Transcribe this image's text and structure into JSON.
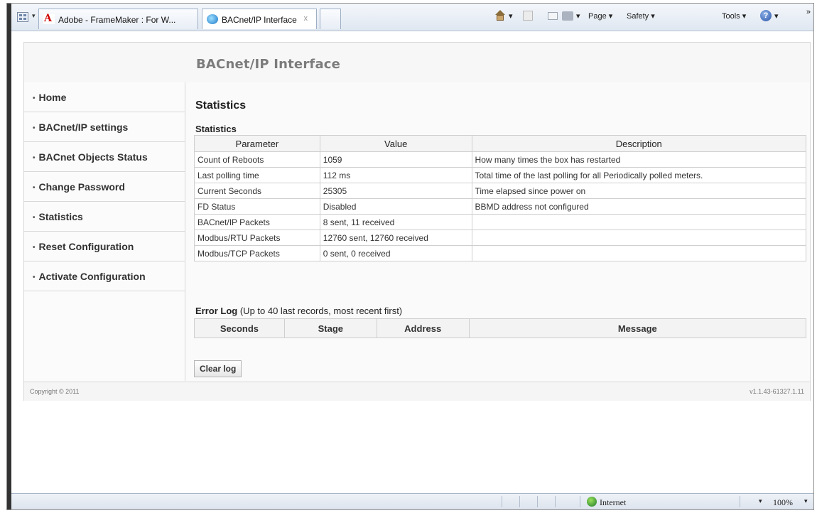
{
  "browser": {
    "tabs": [
      {
        "title": "Adobe - FrameMaker : For W..."
      },
      {
        "title": "BACnet/IP Interface"
      }
    ],
    "tab_close_glyph": "x",
    "commands": {
      "page": "Page",
      "safety": "Safety",
      "tools": "Tools"
    },
    "dropdown_glyph": "▾",
    "more_glyph": "»",
    "status": {
      "zone": "Internet",
      "zoom": "100%"
    }
  },
  "page": {
    "header_title": "BACnet/IP Interface",
    "nav": [
      {
        "label": "Home"
      },
      {
        "label": "BACnet/IP settings"
      },
      {
        "label": "BACnet Objects Status"
      },
      {
        "label": "Change Password"
      },
      {
        "label": "Statistics"
      },
      {
        "label": "Reset Configuration"
      },
      {
        "label": "Activate Configuration"
      }
    ],
    "content_title": "Statistics",
    "stats_section_label": "Statistics",
    "stats_table": {
      "headers": [
        "Parameter",
        "Value",
        "Description"
      ],
      "rows": [
        [
          "Count of Reboots",
          "1059",
          "How many times the box has restarted"
        ],
        [
          "Last polling time",
          "112 ms",
          "Total time of the last polling for all Periodically polled meters."
        ],
        [
          "Current Seconds",
          "25305",
          "Time elapsed since power on"
        ],
        [
          "FD Status",
          "Disabled",
          "BBMD address not configured"
        ],
        [
          "BACnet/IP Packets",
          "8 sent, 11 received",
          ""
        ],
        [
          "Modbus/RTU Packets",
          "12760 sent, 12760 received",
          ""
        ],
        [
          "Modbus/TCP Packets",
          "0 sent, 0 received",
          ""
        ]
      ]
    },
    "error_log": {
      "label_bold": "Error Log",
      "label_rest": " (Up to 40 last records, most recent first)",
      "headers": [
        "Seconds",
        "Stage",
        "Address",
        "Message"
      ]
    },
    "clear_button": "Clear log",
    "footer": {
      "copyright": "Copyright © 2011",
      "version": "v1.1.43-61327.1.11"
    }
  }
}
